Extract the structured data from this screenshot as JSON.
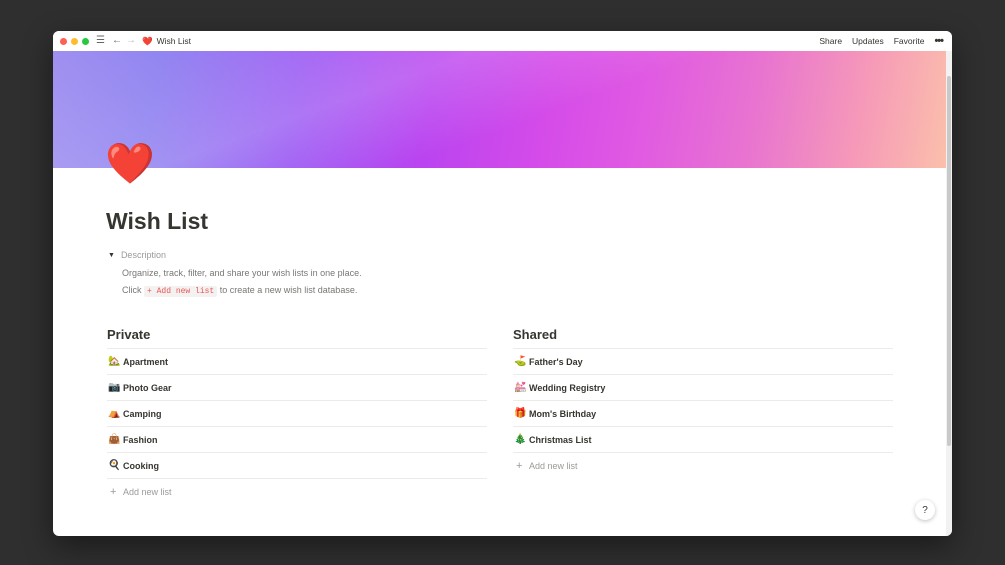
{
  "titlebar": {
    "page_emoji": "❤️",
    "page_title": "Wish List",
    "actions": [
      "Share",
      "Updates",
      "Favorite"
    ],
    "more": "•••"
  },
  "page": {
    "icon": "❤️",
    "title": "Wish List",
    "toggle_label": "Description",
    "desc_line1": "Organize, track, filter, and share your wish lists in one place.",
    "desc_line2_prefix": "Click",
    "desc_line2_code": "+ Add new list",
    "desc_line2_suffix": "to create a new wish list database."
  },
  "private": {
    "title": "Private",
    "items": [
      {
        "emoji": "🏡",
        "label": "Apartment"
      },
      {
        "emoji": "📷",
        "label": "Photo Gear"
      },
      {
        "emoji": "⛺",
        "label": "Camping"
      },
      {
        "emoji": "👜",
        "label": "Fashion"
      },
      {
        "emoji": "🍳",
        "label": "Cooking"
      }
    ],
    "add_label": "Add new list"
  },
  "shared": {
    "title": "Shared",
    "items": [
      {
        "emoji": "⛳",
        "label": "Father's Day"
      },
      {
        "emoji": "💒",
        "label": "Wedding Registry"
      },
      {
        "emoji": "🎁",
        "label": "Mom's Birthday"
      },
      {
        "emoji": "🎄",
        "label": "Christmas List"
      }
    ],
    "add_label": "Add new list"
  },
  "help": "?"
}
